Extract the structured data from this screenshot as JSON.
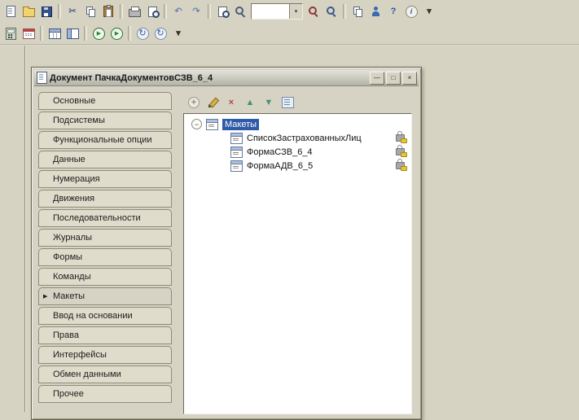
{
  "colors": {
    "background": "#d7d3c3",
    "selection": "#2e5aa8",
    "tree_background": "#ffffff",
    "lock_badge": "#e8c832"
  },
  "toolbar_main": {
    "items": [
      {
        "name": "new-document",
        "icon": "doc"
      },
      {
        "name": "open-document",
        "icon": "open"
      },
      {
        "name": "save",
        "icon": "save"
      },
      {
        "sep": true
      },
      {
        "name": "cut",
        "icon": "glyph",
        "glyph": "✂",
        "color": "#5a6b8c"
      },
      {
        "name": "copy",
        "icon": "copy"
      },
      {
        "name": "paste",
        "icon": "paste"
      },
      {
        "sep": true
      },
      {
        "name": "print",
        "icon": "print"
      },
      {
        "name": "print-preview",
        "icon": "preview"
      },
      {
        "sep": true
      },
      {
        "name": "undo",
        "icon": "glyph",
        "glyph": "↶",
        "color": "#7287b0"
      },
      {
        "name": "redo",
        "icon": "glyph",
        "glyph": "↷",
        "color": "#7287b0"
      },
      {
        "sep": true
      },
      {
        "name": "find-in-file",
        "icon": "magdoc"
      },
      {
        "name": "find",
        "icon": "mag"
      },
      {
        "combo": true,
        "value": ""
      },
      {
        "name": "find-next",
        "icon": "magnext"
      },
      {
        "name": "find-previous",
        "icon": "magprev"
      },
      {
        "sep": true
      },
      {
        "name": "templates",
        "icon": "pages"
      },
      {
        "name": "syntax-check",
        "icon": "person"
      },
      {
        "name": "help",
        "icon": "glyph",
        "glyph": "?",
        "color": "#2a52a0"
      },
      {
        "name": "about",
        "icon": "info",
        "glyph": "i"
      },
      {
        "name": "toolbar-options",
        "icon": "glyph",
        "glyph": "▾",
        "color": "#333333"
      }
    ]
  },
  "toolbar_secondary": {
    "items": [
      {
        "name": "calculator",
        "icon": "calc"
      },
      {
        "name": "calendar",
        "icon": "cal"
      },
      {
        "sep": true
      },
      {
        "name": "spreadsheet-document",
        "icon": "table"
      },
      {
        "name": "form",
        "icon": "form"
      },
      {
        "sep": true
      },
      {
        "name": "start-debugging",
        "icon": "play",
        "glyph": "▶"
      },
      {
        "name": "start-debugging-options",
        "icon": "play",
        "glyph": "▶"
      },
      {
        "sep": true
      },
      {
        "name": "update-database-configuration",
        "icon": "refresh",
        "glyph": "↻"
      },
      {
        "name": "refresh-configuration",
        "icon": "refresh",
        "glyph": "↻"
      },
      {
        "name": "toolbar-options",
        "icon": "glyph",
        "glyph": "▾",
        "color": "#333333"
      }
    ]
  },
  "dialog": {
    "title": "Документ ПачкаДокументовСЗВ_6_4",
    "window_buttons": [
      {
        "name": "minimize",
        "glyph": "—"
      },
      {
        "name": "maximize",
        "glyph": "□"
      },
      {
        "name": "close",
        "glyph": "×"
      }
    ],
    "tabs": [
      "Основные",
      "Подсистемы",
      "Функциональные опции",
      "Данные",
      "Нумерация",
      "Движения",
      "Последовательности",
      "Журналы",
      "Формы",
      "Команды",
      "Макеты",
      "Ввод на основании",
      "Права",
      "Интерфейсы",
      "Обмен данными",
      "Прочее"
    ],
    "selected_tab": "Макеты",
    "content_toolbar": [
      {
        "name": "add",
        "icon": "add",
        "glyph": "+"
      },
      {
        "name": "edit",
        "icon": "pencil"
      },
      {
        "name": "delete",
        "icon": "glyph",
        "glyph": "×",
        "color": "#b84040"
      },
      {
        "name": "move-up",
        "icon": "glyph",
        "glyph": "▲",
        "color": "#4a8f7a"
      },
      {
        "name": "move-down",
        "icon": "glyph",
        "glyph": "▼",
        "color": "#4a8f7a"
      },
      {
        "name": "set-order",
        "icon": "order"
      }
    ],
    "tree": {
      "root": {
        "label": "Макеты",
        "expanded": true
      },
      "items": [
        {
          "label": "СписокЗастрахованныхЛиц",
          "locked": true
        },
        {
          "label": "ФормаСЗВ_6_4",
          "locked": true
        },
        {
          "label": "ФормаАДВ_6_5",
          "locked": true
        }
      ]
    }
  }
}
